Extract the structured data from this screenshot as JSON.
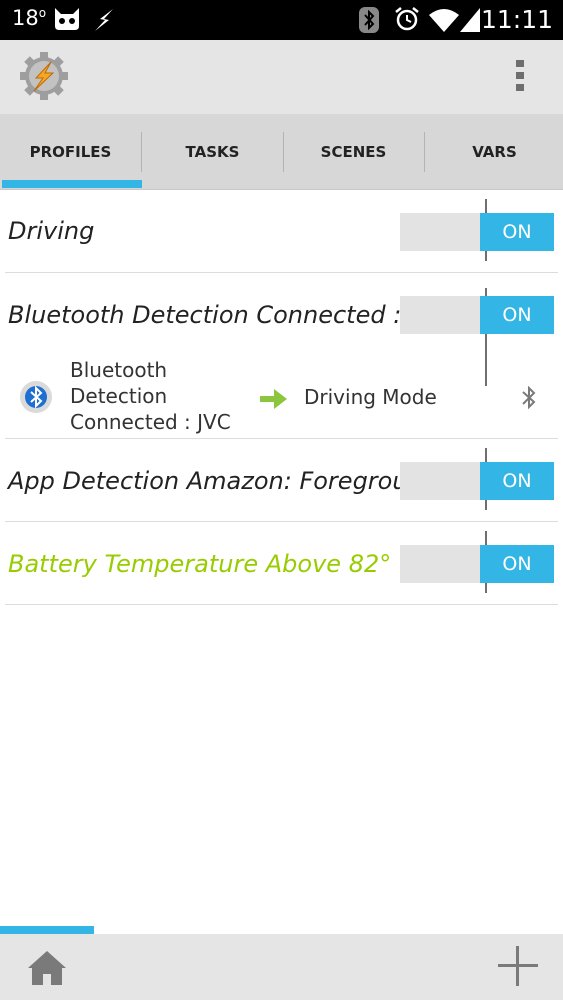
{
  "status_bar": {
    "temperature": "18",
    "degree": "o",
    "time": "11:11",
    "icons": [
      "cyanogenmod-icon",
      "flash-icon",
      "bluetooth-icon",
      "alarm-icon",
      "wifi-icon",
      "signal-icon"
    ]
  },
  "action_bar": {
    "logo_icon": "tasker-gear-icon",
    "overflow_icon": "overflow-menu-icon"
  },
  "tabs": [
    {
      "label": "PROFILES",
      "selected": true
    },
    {
      "label": "TASKS",
      "selected": false
    },
    {
      "label": "SCENES",
      "selected": false
    },
    {
      "label": "VARS",
      "selected": false
    }
  ],
  "profiles": [
    {
      "name": "Driving",
      "toggle": "ON"
    },
    {
      "name": "Bluetooth Detection Connected : J",
      "toggle": "ON",
      "context": {
        "text_line1": "Bluetooth",
        "text_line2": "Detection",
        "text_line3": "Connected : JVC",
        "icon": "bluetooth-circle-icon"
      },
      "task": {
        "text": "Driving Mode",
        "arrow_icon": "arrow-right-icon",
        "indicator_icon": "bluetooth-icon"
      }
    },
    {
      "name": "App Detection Amazon: Foregrour",
      "toggle": "ON"
    },
    {
      "name": "Battery Temperature Above 82°",
      "toggle": "ON"
    }
  ],
  "colors": {
    "accent": "#33b5e5",
    "green": "#99cc00",
    "tab_bg": "#d7d7d7",
    "bar_bg": "#e5e5e5"
  },
  "bottom_bar": {
    "home_icon": "home-icon",
    "add_icon": "plus-icon"
  }
}
